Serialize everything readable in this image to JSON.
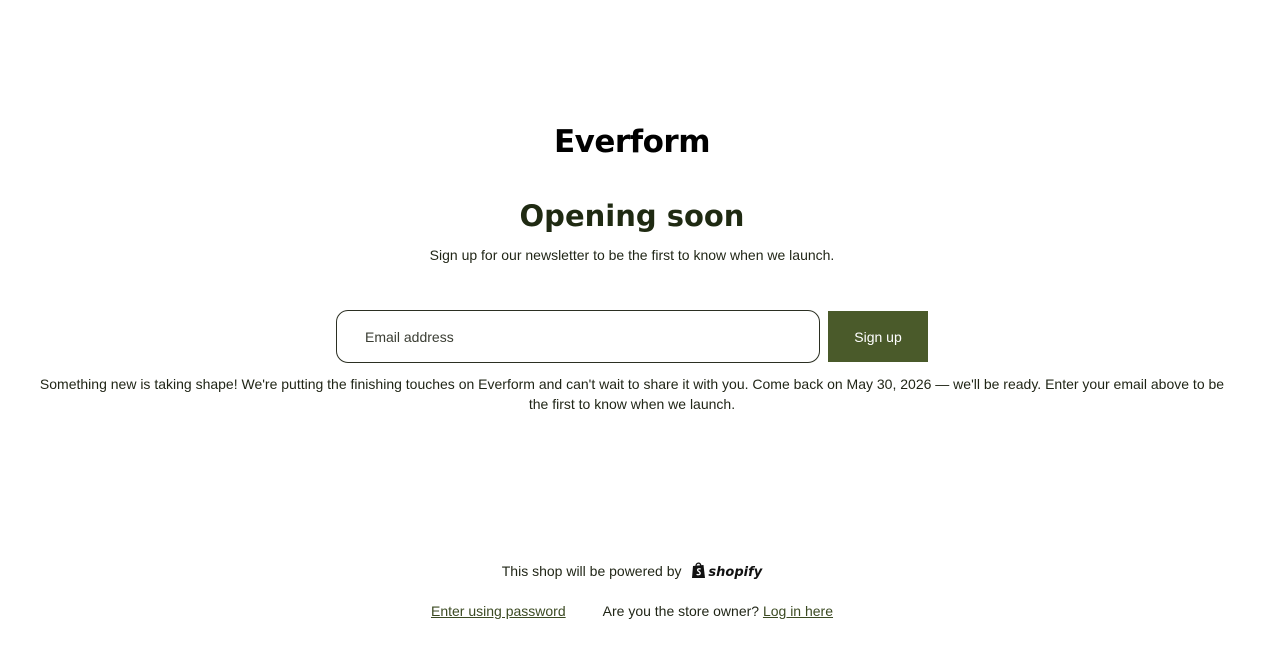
{
  "store": {
    "name": "Everform"
  },
  "hero": {
    "heading": "Opening soon",
    "subheading": "Sign up for our newsletter to be the first to know when we launch."
  },
  "newsletter": {
    "email_placeholder": "Email address",
    "email_value": "",
    "submit_label": "Sign up"
  },
  "message": "Something new is taking shape! We're putting the finishing touches on Everform and can't wait to share it with you. Come back on May 30, 2026 — we'll be ready. Enter your email above to be the first to know when we launch.",
  "footer": {
    "powered_by_text": "This shop will be powered by",
    "powered_by_logo_word": "shopify",
    "password_link": "Enter using password",
    "owner_prompt": "Are you the store owner?",
    "login_link": "Log in here"
  },
  "colors": {
    "button_background": "#4a5a2a",
    "text": "#1f2415",
    "link": "#3b4a22"
  },
  "icons": {
    "powered_logo": "shopify-bag-icon"
  }
}
